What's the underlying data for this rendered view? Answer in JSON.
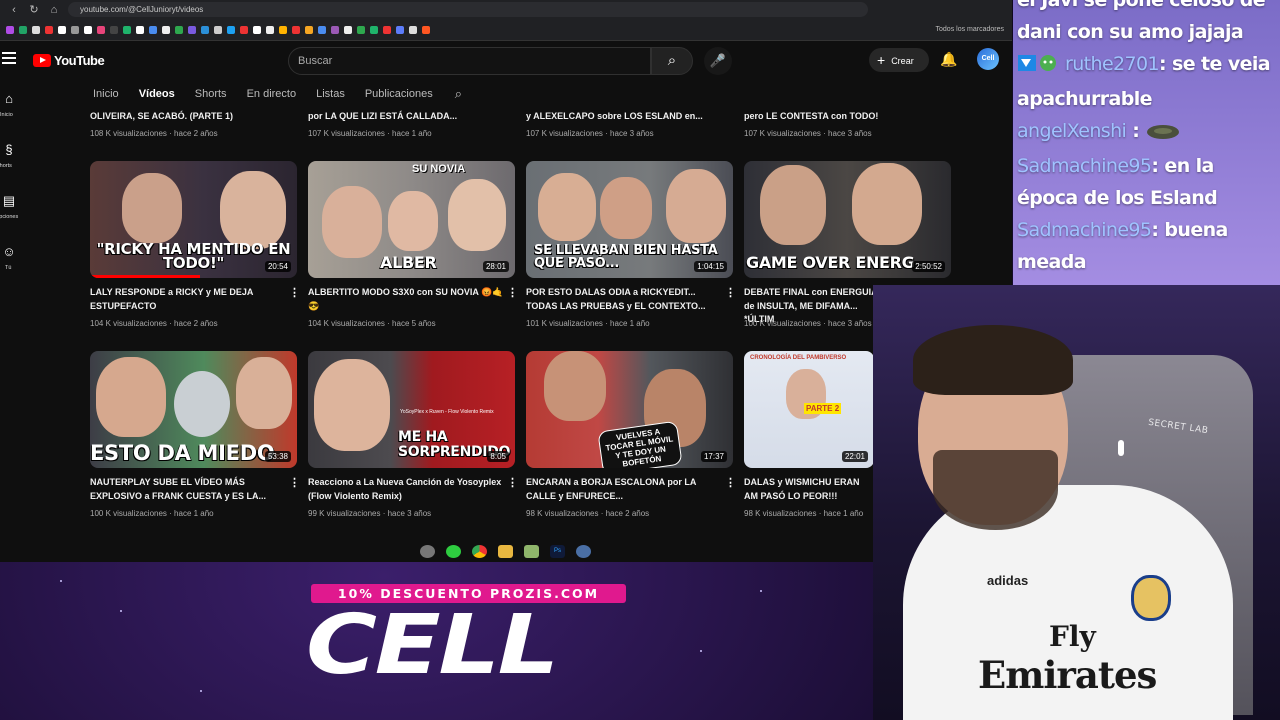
{
  "browser": {
    "url": "youtube.com/@CellJunioryt/videos",
    "bookmarks_label": "Todos los marcadores"
  },
  "youtube": {
    "logo_text": "YouTube",
    "search_placeholder": "Buscar",
    "create_label": "Crear",
    "avatar_text": "Cell",
    "sidebar": [
      {
        "label": "Inicio",
        "icon": "home-icon"
      },
      {
        "label": "Shorts",
        "icon": "shorts-icon"
      },
      {
        "label": "Suscripciones",
        "icon": "subscriptions-icon"
      },
      {
        "label": "Tú",
        "icon": "you-icon"
      }
    ],
    "tabs": [
      "Inicio",
      "Vídeos",
      "Shorts",
      "En directo",
      "Listas",
      "Publicaciones"
    ],
    "active_tab": "Vídeos",
    "row0": [
      {
        "title": "OLIVEIRA, SE ACABÓ. (PARTE 1)",
        "meta": "108 K visualizaciones · hace 2 años"
      },
      {
        "title": "por LA QUE LIZI ESTÁ CALLADA...",
        "meta": "107 K visualizaciones · hace 1 año"
      },
      {
        "title": "y ALEXELCAPO sobre LOS ESLAND en...",
        "meta": "107 K visualizaciones · hace 3 años"
      },
      {
        "title": "pero LE CONTESTA con TODO!",
        "meta": "107 K visualizaciones · hace 3 años"
      }
    ],
    "row1": [
      {
        "title": "LALY RESPONDE a RICKY y ME DEJA ESTUPEFACTO",
        "meta": "104 K visualizaciones · hace 2 años",
        "duration": "20:54",
        "caption": "\"RICKY HA MENTIDO EN TODO!\""
      },
      {
        "title": "ALBERTITO MODO S3X0 con SU NOVIA 😡🤙😎",
        "meta": "104 K visualizaciones · hace 5 años",
        "duration": "28:01",
        "caption": "ALBER",
        "badge": "SU NOVIA"
      },
      {
        "title": "POR ESTO DALAS ODIA a RICKYEDIT... TODAS LAS PRUEBAS y EL CONTEXTO...",
        "meta": "101 K visualizaciones · hace 1 año",
        "duration": "1:04:15",
        "caption": "SE LLEVABAN BIEN HASTA QUE PASÓ..."
      },
      {
        "title": "DEBATE FINAL con ENERGUIA de INSULTA, ME DIFAMA... *ÚLTIM",
        "meta": "100 K visualizaciones · hace 3 años",
        "duration": "2:50:52",
        "caption": "GAME OVER ENERG"
      }
    ],
    "row2": [
      {
        "title": "NAUTERPLAY SUBE EL VÍDEO MÁS EXPLOSIVO a FRANK CUESTA y ES LA...",
        "meta": "100 K visualizaciones · hace 1 año",
        "duration": "53:38",
        "caption": "ESTO DA MIEDO"
      },
      {
        "title": "Reacciono a La Nueva Canción de Yosoyplex (Flow Violento Remix)",
        "meta": "99 K visualizaciones · hace 3 años",
        "duration": "8:05",
        "caption": "ME HA SORPRENDIDO",
        "badge": "YoSoyPlex x Ruven - Flow Violento Remix"
      },
      {
        "title": "ENCARAN a BORJA ESCALONA por LA CALLE y ENFURECE...",
        "meta": "98 K visualizaciones · hace 2 años",
        "duration": "17:37",
        "caption": "VUELVES A TOCAR EL MÓVIL Y TE DOY UN BOFETÓN"
      },
      {
        "title": "DALAS y WISMICHU ERAN AM PASÓ LO PEOR!!!",
        "meta": "98 K visualizaciones · hace 1 año",
        "duration": "22:01",
        "caption": "CRONOLOGÍA DEL PAMBIVERSO",
        "badge": "PARTE 2"
      }
    ]
  },
  "chat": [
    {
      "user": "",
      "text": "el Javi se pone celoso de"
    },
    {
      "user": "",
      "text": "dani con su amo jajaja"
    },
    {
      "user": "ruthe2701",
      "text": ": se te veia"
    },
    {
      "user": "",
      "text": "apachurrable"
    },
    {
      "user": "angelXenshi",
      "text": ":"
    },
    {
      "user": "Sadmachine95",
      "text": ": en la"
    },
    {
      "user": "",
      "text": "época de los Esland"
    },
    {
      "user": "Sadmachine95",
      "text": ": buena"
    },
    {
      "user": "",
      "text": "meada"
    }
  ],
  "webcam": {
    "chair_logo": "SECRET LAB",
    "shirt_brand": "adidas",
    "shirt_sponsor_line1": "Fly",
    "shirt_sponsor_line2": "Emirates"
  },
  "promo": {
    "tag": "10% DESCUENTO PROZIS.COM",
    "big_text": "CELL"
  }
}
